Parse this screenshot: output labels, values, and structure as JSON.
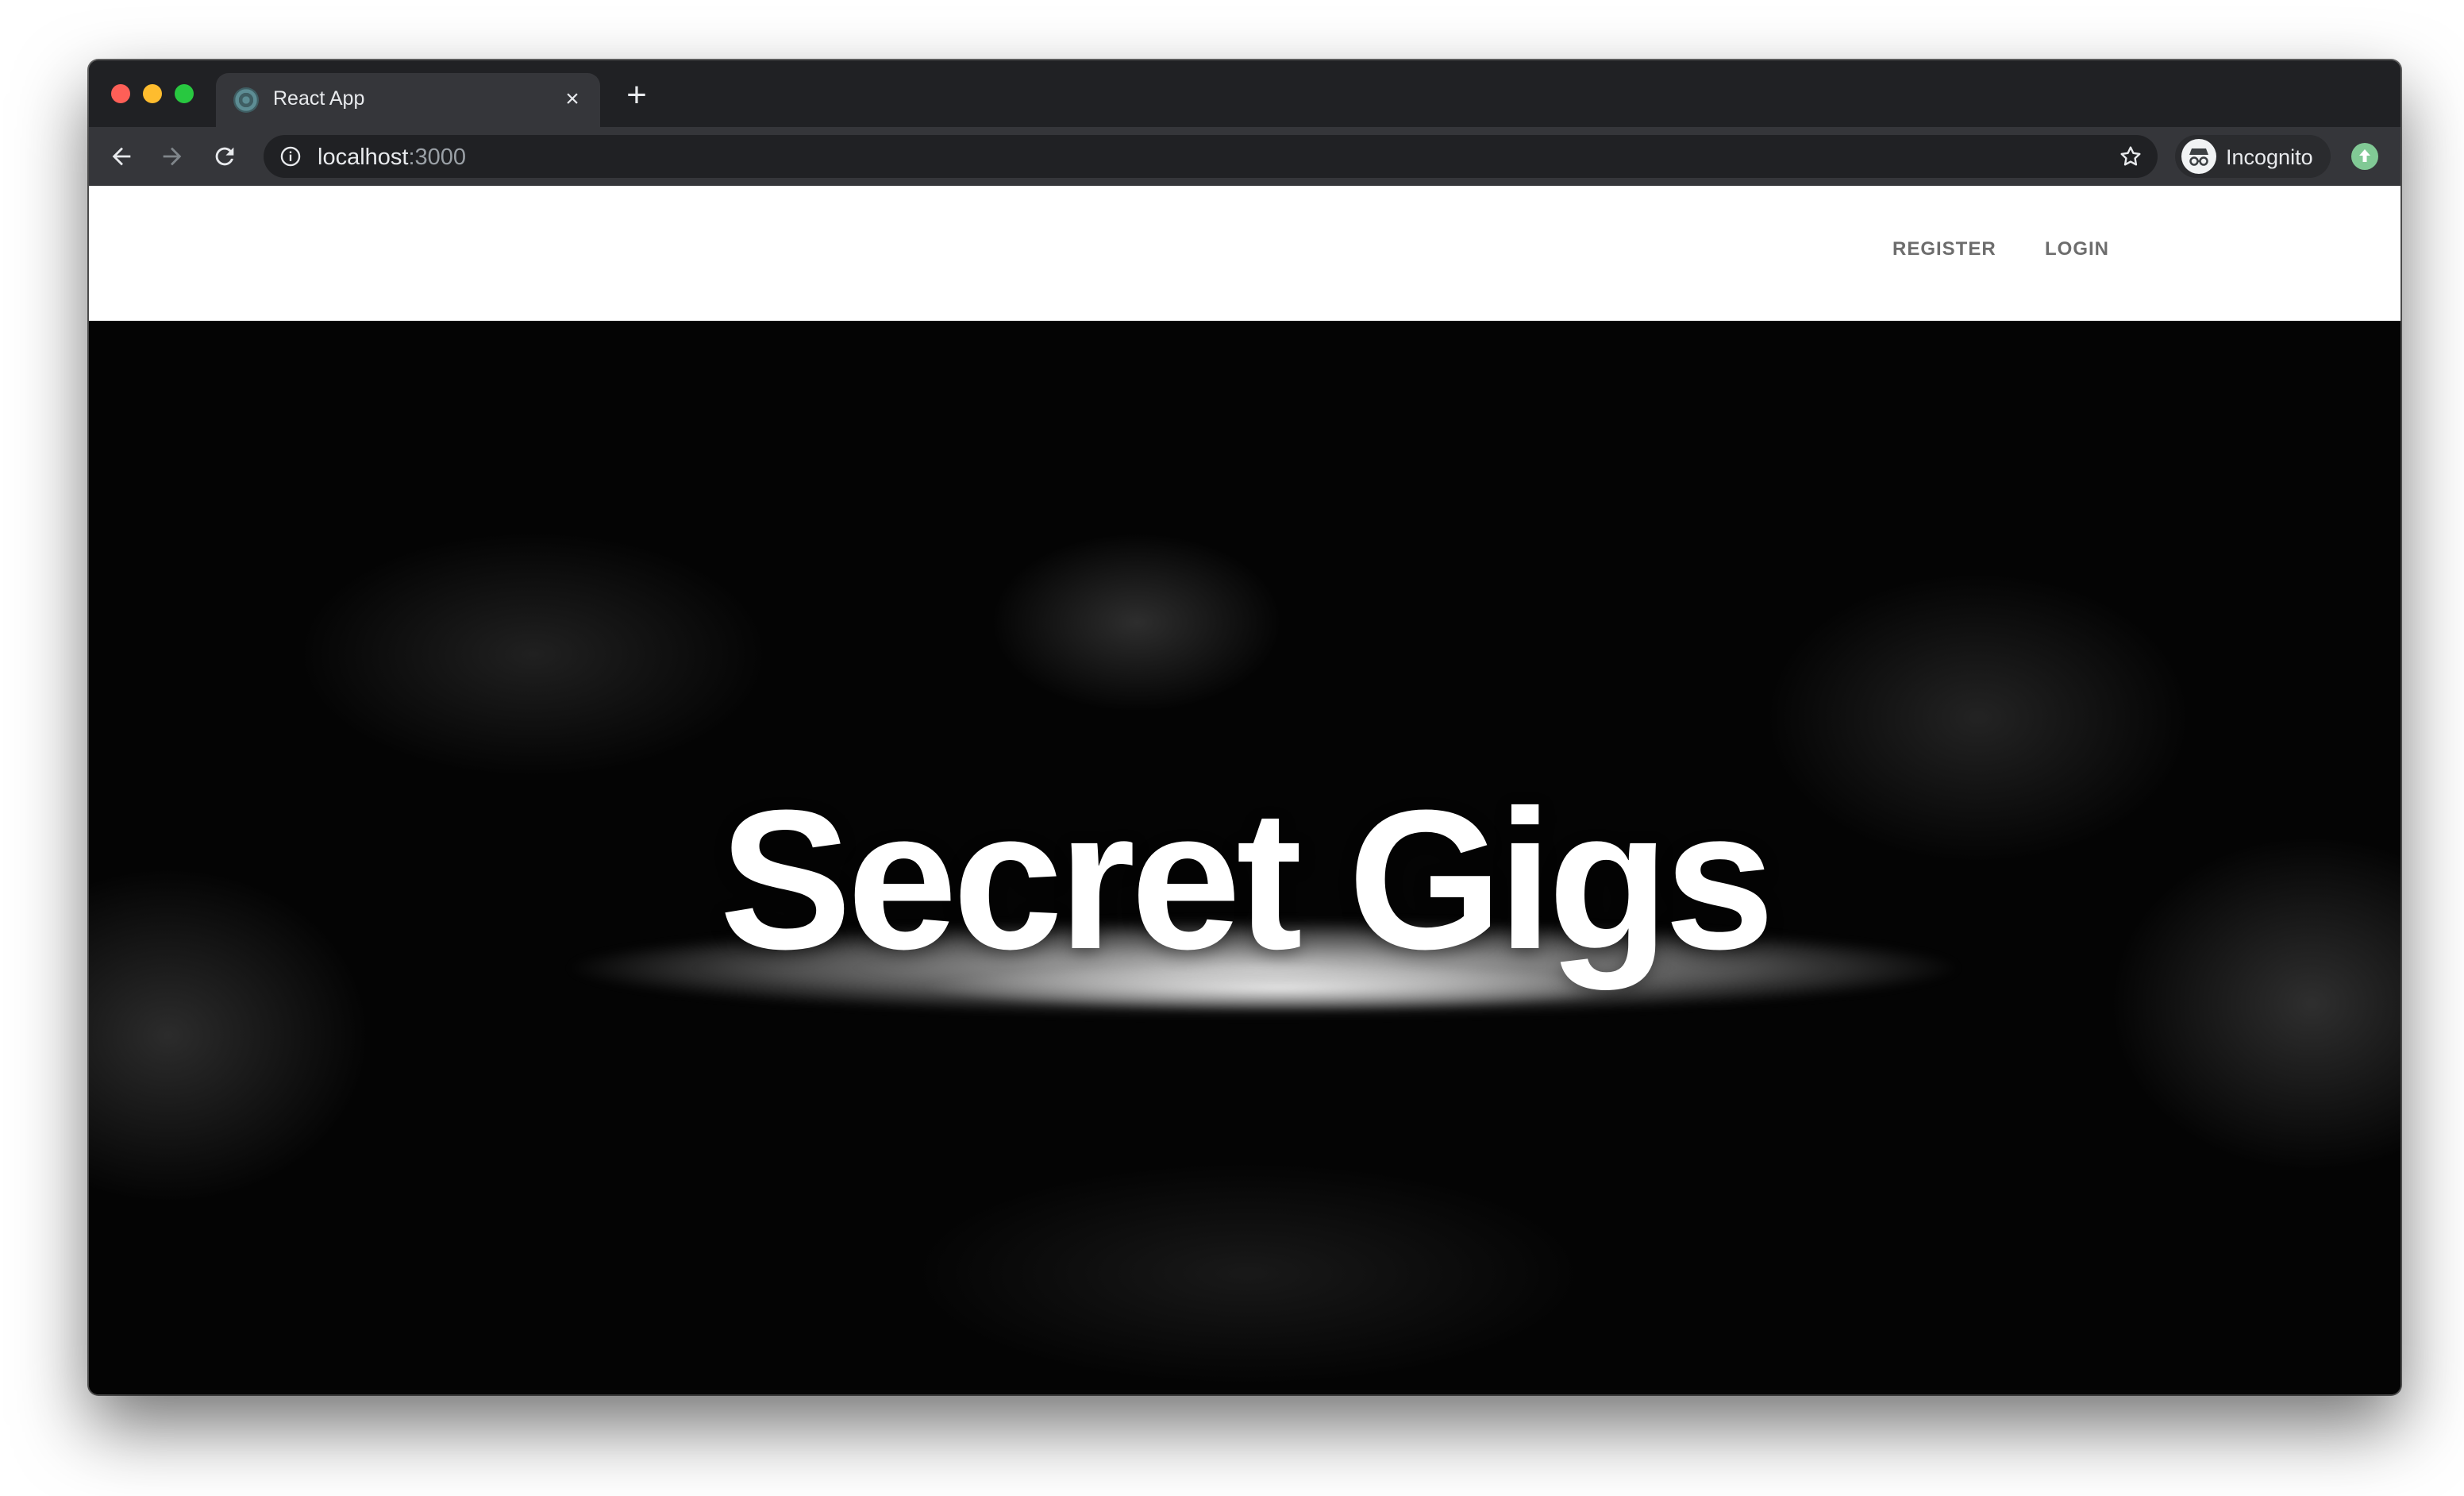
{
  "browser": {
    "tab": {
      "title": "React App",
      "close_glyph": "×",
      "favicon": "react-favicon-icon"
    },
    "new_tab_glyph": "+",
    "address": {
      "host": "localhost",
      "port": ":3000"
    },
    "profile": {
      "label": "Incognito"
    }
  },
  "page": {
    "nav": {
      "register": "REGISTER",
      "login": "LOGIN"
    },
    "hero": {
      "title": "Secret Gigs"
    }
  },
  "colors": {
    "chrome_dark": "#202124",
    "toolbar": "#35363a",
    "nav_text": "#6d6d6d",
    "hero_bg": "#040404",
    "update_badge": "#81c995"
  }
}
